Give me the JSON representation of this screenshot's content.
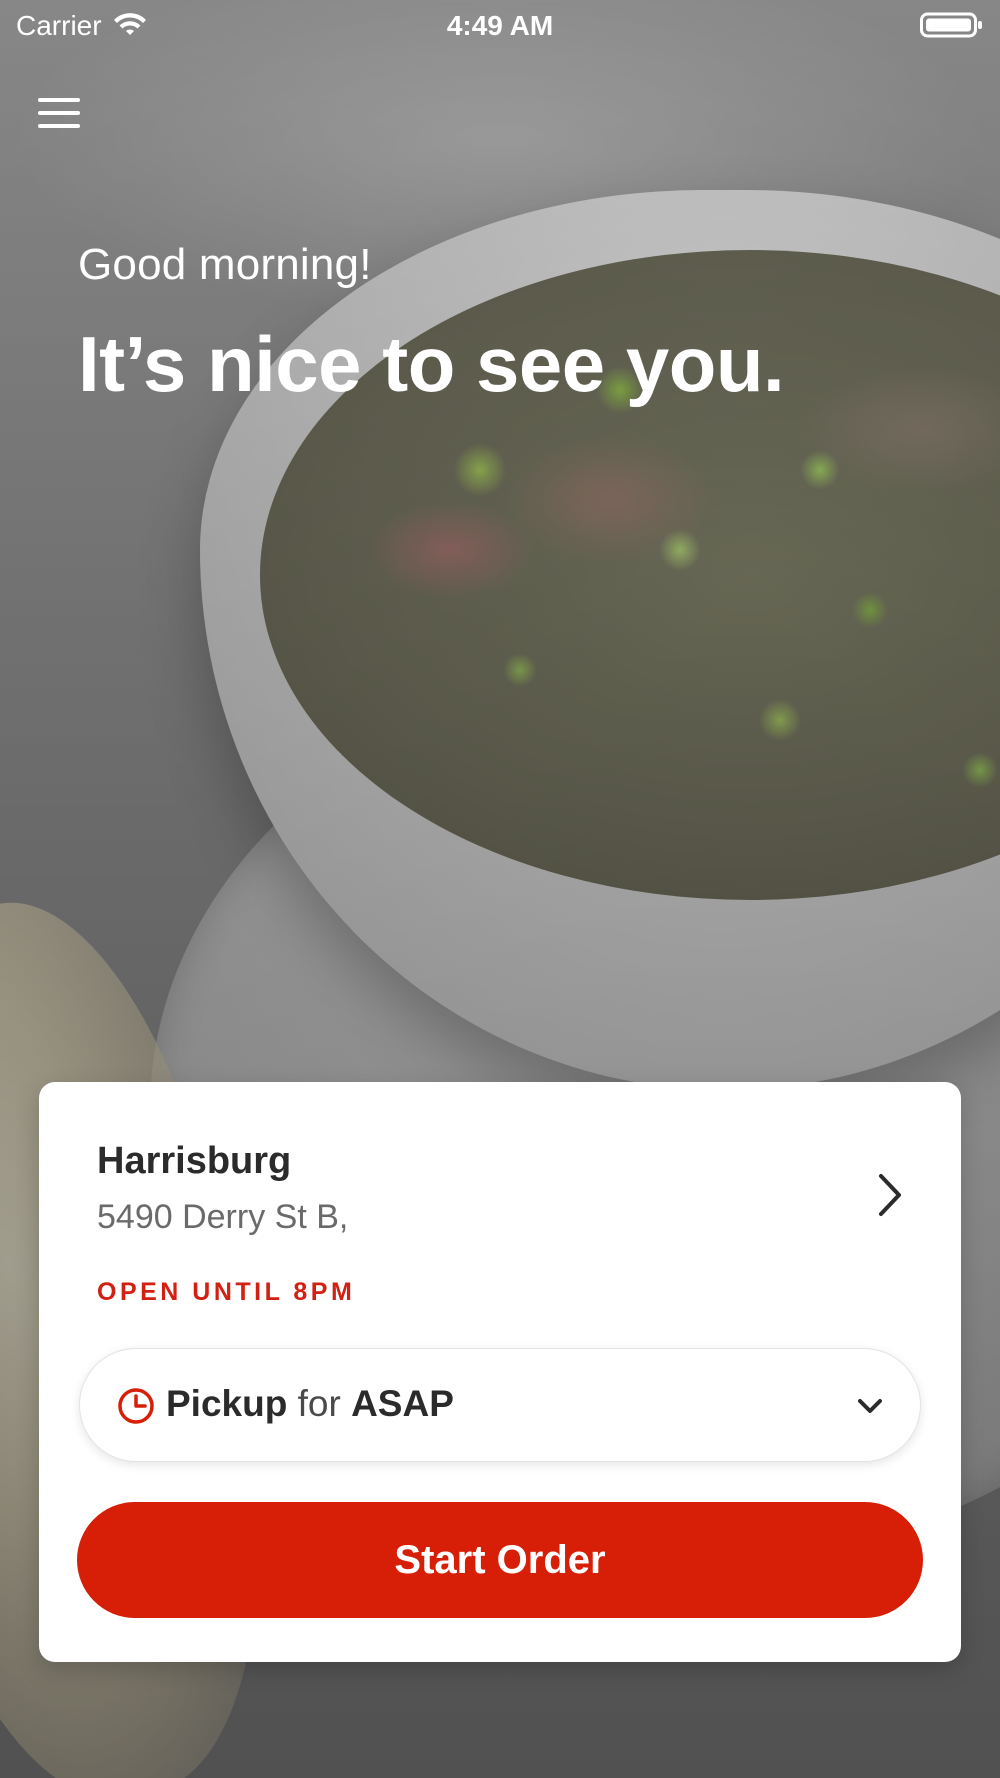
{
  "status_bar": {
    "carrier": "Carrier",
    "time": "4:49 AM",
    "icons": [
      "wifi-icon",
      "battery-icon"
    ]
  },
  "header": {
    "menu_icon": "hamburger-menu-icon"
  },
  "hero": {
    "greeting": "Good morning!",
    "headline": "It’s nice to see you."
  },
  "location_card": {
    "name": "Harrisburg",
    "address": "5490 Derry St B,",
    "status": "OPEN UNTIL 8PM",
    "status_color": "#d22012",
    "chevron_icon": "chevron-right-icon"
  },
  "order_mode": {
    "icon": "clock-icon",
    "mode": "Pickup",
    "connector": "for",
    "time": "ASAP",
    "dropdown_icon": "chevron-down-icon"
  },
  "cta": {
    "label": "Start Order",
    "color": "#d71f07"
  }
}
